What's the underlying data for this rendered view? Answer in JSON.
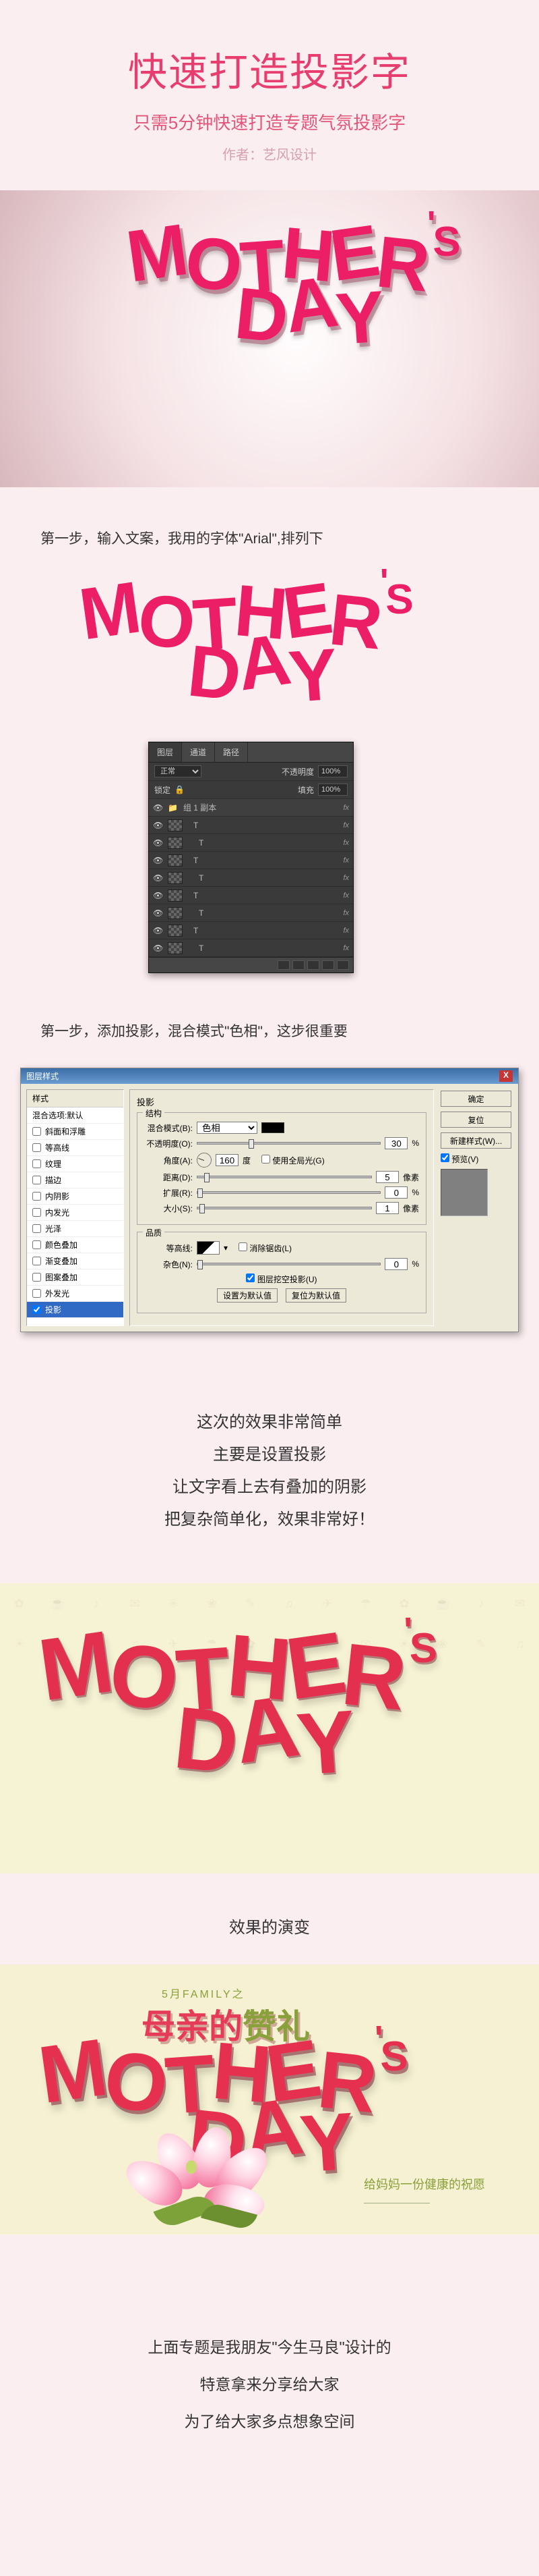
{
  "header": {
    "title": "快速打造投影字",
    "subtitle": "只需5分钟快速打造专题气氛投影字",
    "author": "作者：艺风设计"
  },
  "hero": {
    "line1": "MOTHER'S",
    "line2": "DAY"
  },
  "step1": {
    "label": "第一步，输入文案，我用的字体\"Arial\",排列下"
  },
  "layers_panel": {
    "tabs": [
      "图层",
      "通道",
      "路径"
    ],
    "kind_label": "正常",
    "opacity_label": "不透明度",
    "opacity_value": "100%",
    "lock_label": "锁定",
    "fill_label": "填充",
    "fill_value": "100%",
    "group": "组 1 副本",
    "fx": "fx",
    "layers": [
      "T",
      "T",
      "T",
      "T",
      "T",
      "T",
      "T",
      "T"
    ]
  },
  "step2": {
    "label": "第一步，添加投影，混合模式\"色相\"，这步很重要"
  },
  "dialog": {
    "title": "图层样式",
    "close": "X",
    "left_header": "样式",
    "default_option": "混合选项:默认",
    "options": [
      "斜面和浮雕",
      "等高线",
      "纹理",
      "描边",
      "内阴影",
      "内发光",
      "光泽",
      "颜色叠加",
      "渐变叠加",
      "图案叠加",
      "外发光",
      "投影"
    ],
    "selected": "投影",
    "section": "投影",
    "structure": "结构",
    "blend_mode": "混合模式(B):",
    "blend_value": "色相",
    "opacity": "不透明度(O):",
    "opacity_val": "30",
    "pct": "%",
    "angle": "角度(A):",
    "angle_val": "160",
    "deg": "度",
    "global": "使用全局光(G)",
    "distance": "距离(D):",
    "distance_val": "5",
    "px": "像素",
    "spread": "扩展(R):",
    "spread_val": "0",
    "size": "大小(S):",
    "size_val": "1",
    "quality": "品质",
    "contour": "等高线:",
    "anti": "消除锯齿(L)",
    "noise": "杂色(N):",
    "noise_val": "0",
    "knockout": "图层挖空投影(U)",
    "make_default": "设置为默认值",
    "reset_default": "复位为默认值",
    "ok": "确定",
    "cancel": "复位",
    "new_style": "新建样式(W)...",
    "preview": "预览(V)"
  },
  "summary": {
    "l1": "这次的效果非常简单",
    "l2": "主要是设置投影",
    "l3": "让文字看上去有叠加的阴影",
    "l4": "把复杂简单化，效果非常好！"
  },
  "evo_title": "效果的演变",
  "banner3": {
    "pretitle": "5月FAMILY之",
    "cntitle_a": "母亲的",
    "cntitle_b": "赞礼",
    "caption1": "给妈妈一份健康的祝愿",
    "caption2": "———————"
  },
  "closing": {
    "l1": "上面专题是我朋友\"今生马良\"设计的",
    "l2": "特意拿来分享给大家",
    "l3": "为了给大家多点想象空间"
  }
}
